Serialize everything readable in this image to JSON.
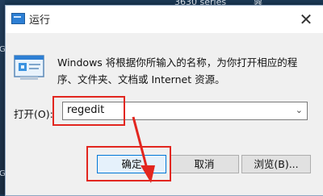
{
  "background": {
    "top_text": "3630 series",
    "top_right_glyph": "器",
    "left_texts": [
      "窟",
      "Ge",
      "Ge"
    ]
  },
  "dialog": {
    "title": "运行",
    "close_glyph": "✕",
    "description": "Windows 将根据你所输入的名称，为你打开相应的程序、文件夹、文档或 Internet 资源。",
    "open_label": "打开(O):",
    "open_value": "regedit",
    "combo_arrow": "⌄",
    "buttons": {
      "ok": "确定",
      "cancel": "取消",
      "browse": "浏览(B)..."
    }
  },
  "colors": {
    "highlight": "#e2261f",
    "accent": "#0078d7"
  },
  "icons": {
    "title": "run-icon",
    "dialog": "run-program-icon"
  }
}
